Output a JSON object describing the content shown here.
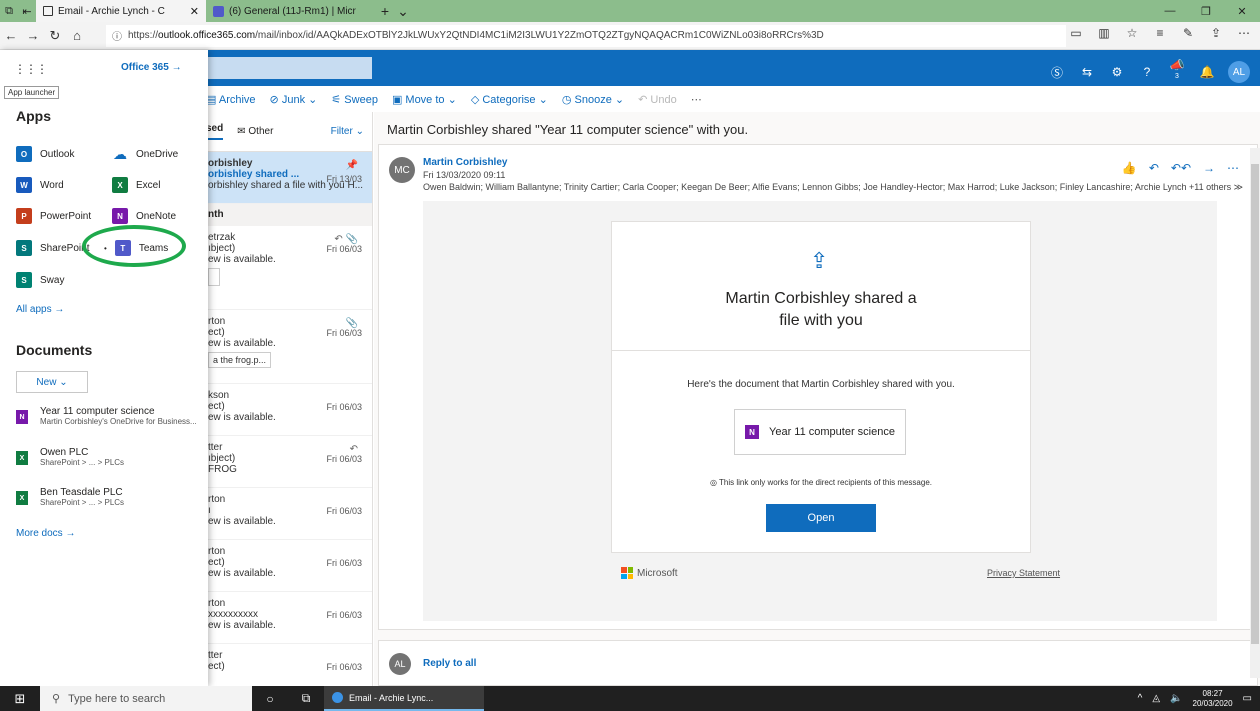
{
  "browser": {
    "tabs": [
      {
        "label": "Email - Archie Lynch - C",
        "active": true
      },
      {
        "label": "(6) General (11J-Rm1) | Micr",
        "active": false
      }
    ],
    "url_prefix": "https://",
    "url_host": "outlook.office365.com",
    "url_path": "/mail/inbox/id/AAQkADExOTBlY2JkLWUxY2QtNDI4MC1iM2I3LWU1Y2ZmOTQ2ZTgyNQAQACRm1C0WiZNLo03i8oRRCrs%3D"
  },
  "owa": {
    "avatar_initials": "AL",
    "notification_count": "3"
  },
  "command_bar": {
    "archive": "Archive",
    "junk": "Junk",
    "sweep": "Sweep",
    "move_to": "Move to",
    "categorise": "Categorise",
    "snooze": "Snooze",
    "undo": "Undo"
  },
  "message_list": {
    "focused": "sed",
    "other": "Other",
    "filter": "Filter",
    "selected": {
      "l1": "orbishley",
      "l2": "orbishley shared ...",
      "l3": "orbishley shared a file with you H...",
      "date": "Fri 13/03"
    },
    "section": "nth",
    "items": [
      {
        "l1": "etrzak",
        "l2": "ıbject)",
        "l3": "ew is available.",
        "date": "Fri 06/03",
        "chip": ""
      },
      {
        "l1": "rton",
        "l2": "ect)",
        "l3": "ew is available.",
        "date": "Fri 06/03",
        "chip": "a the frog.p..."
      },
      {
        "l1": "kson",
        "l2": "ect)",
        "l3": "ew is available.",
        "date": "Fri 06/03",
        "chip": ""
      },
      {
        "l1": "tter",
        "l2": "ıbject)",
        "l3": "FROG",
        "date": "Fri 06/03",
        "chip": ""
      },
      {
        "l1": "rton",
        "l2": "ı",
        "l3": "ew is available.",
        "date": "Fri 06/03",
        "chip": ""
      },
      {
        "l1": "rton",
        "l2": "ect)",
        "l3": "ew is available.",
        "date": "Fri 06/03",
        "chip": ""
      },
      {
        "l1": "rton",
        "l2": "xxxxxxxxxx",
        "l3": "ew is available.",
        "date": "Fri 06/03",
        "chip": ""
      },
      {
        "l1": "tter",
        "l2": "ect)",
        "l3": "",
        "date": "Fri 06/03",
        "chip": ""
      }
    ]
  },
  "reading": {
    "subject": "Martin Corbishley shared \"Year 11 computer science\" with you.",
    "sender_initials": "MC",
    "sender": "Martin Corbishley",
    "sent": "Fri 13/03/2020 09:11",
    "recipients": "Owen Baldwin; William Ballantyne; Trinity Cartier; Carla Cooper; Keegan De Beer; Alfie Evans; Lennon Gibbs; Joe Handley-Hector; Max Harrod; Luke Jackson; Finley Lancashire; Archie Lynch +11 others",
    "panel_title": "Martin Corbishley shared a file with you",
    "panel_text": "Here's the document that Martin Corbishley shared with you.",
    "doc_name": "Year 11 computer science",
    "link_note": "This link only works for the direct recipients of this message.",
    "open": "Open",
    "microsoft": "Microsoft",
    "privacy": "Privacy Statement",
    "reply_initials": "AL",
    "reply_all": "Reply to all"
  },
  "launcher": {
    "office365": "Office 365",
    "tooltip": "App launcher",
    "apps_heading": "Apps",
    "apps": [
      {
        "name": "Outlook",
        "icon": "O",
        "color": "#0f6cbd"
      },
      {
        "name": "OneDrive",
        "icon": "",
        "color": "#0f6cbd"
      },
      {
        "name": "Word",
        "icon": "W",
        "color": "#185abd"
      },
      {
        "name": "Excel",
        "icon": "X",
        "color": "#107c41"
      },
      {
        "name": "PowerPoint",
        "icon": "P",
        "color": "#c43e1c"
      },
      {
        "name": "OneNote",
        "icon": "N",
        "color": "#7719aa"
      },
      {
        "name": "SharePoint",
        "icon": "S",
        "color": "#03787c"
      },
      {
        "name": "Teams",
        "icon": "T",
        "color": "#5059c9"
      },
      {
        "name": "Sway",
        "icon": "S",
        "color": "#008272"
      }
    ],
    "all_apps": "All apps",
    "docs_heading": "Documents",
    "new": "New",
    "docs": [
      {
        "title": "Year 11 computer science",
        "sub": "Martin Corbishley's OneDrive for Business...",
        "icon": "N",
        "color": "#7719aa"
      },
      {
        "title": "Owen PLC",
        "sub": "SharePoint > ... > PLCs",
        "icon": "X",
        "color": "#107c41"
      },
      {
        "title": "Ben Teasdale PLC",
        "sub": "SharePoint > ... > PLCs",
        "icon": "X",
        "color": "#107c41"
      }
    ],
    "more_docs": "More docs"
  },
  "taskbar": {
    "search_placeholder": "Type here to search",
    "app_label": "Email - Archie Lync...",
    "time": "08:27",
    "date": "20/03/2020"
  }
}
